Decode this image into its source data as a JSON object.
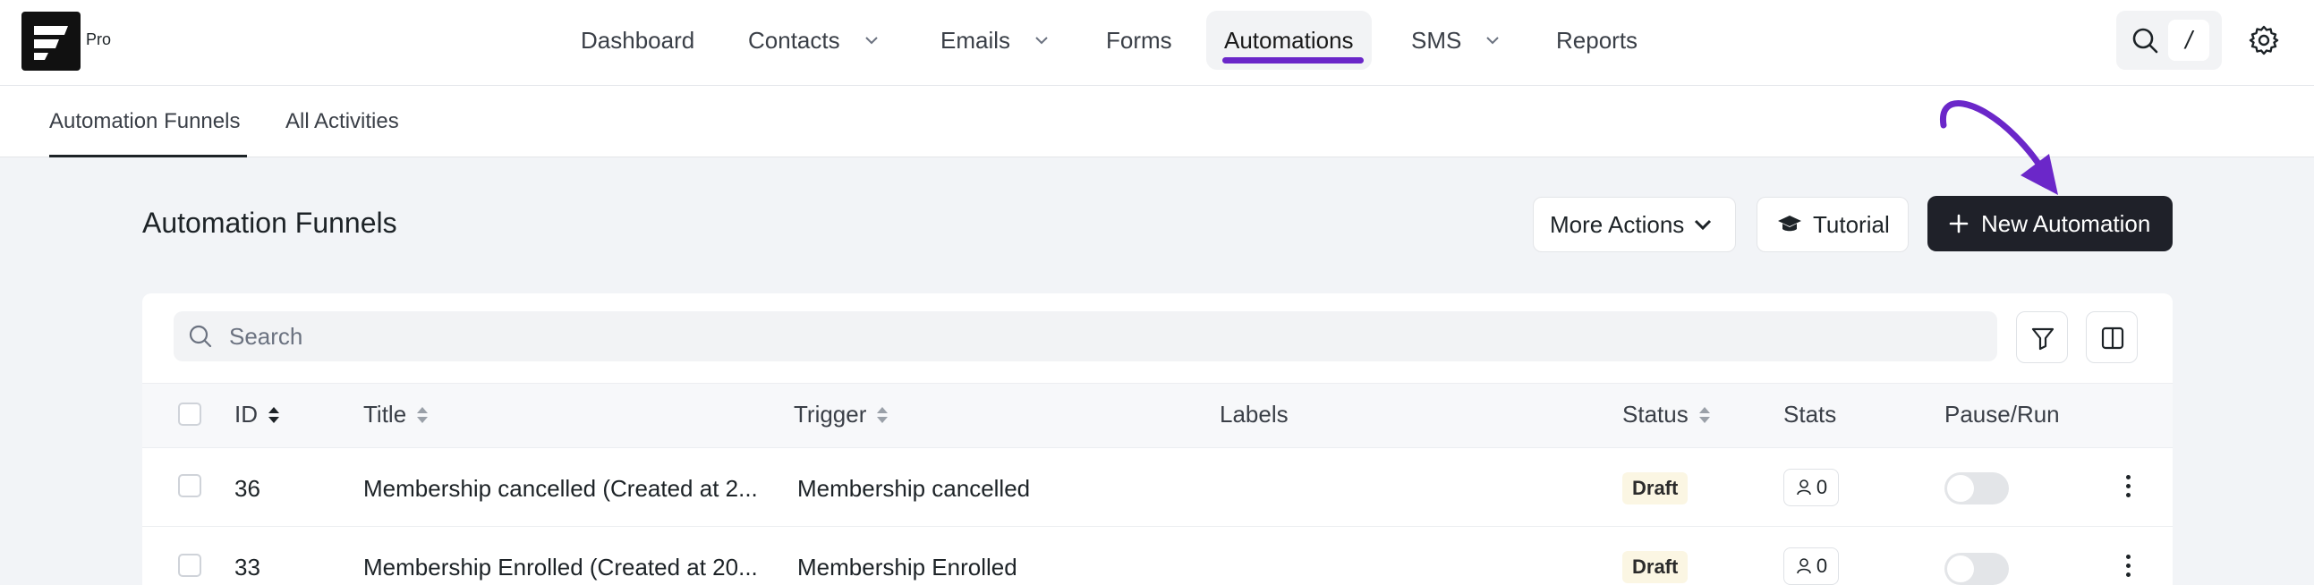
{
  "app": {
    "edition": "Pro"
  },
  "nav": {
    "items": [
      {
        "label": "Dashboard"
      },
      {
        "label": "Contacts"
      },
      {
        "label": "Emails"
      },
      {
        "label": "Forms"
      },
      {
        "label": "Automations"
      },
      {
        "label": "SMS"
      },
      {
        "label": "Reports"
      }
    ],
    "active": "Automations",
    "search_shortcut": "/"
  },
  "subtabs": [
    {
      "label": "Automation Funnels"
    },
    {
      "label": "All Activities"
    }
  ],
  "page": {
    "title": "Automation Funnels",
    "more_actions": "More Actions",
    "tutorial": "Tutorial",
    "new_automation": "New Automation"
  },
  "search": {
    "placeholder": "Search"
  },
  "table": {
    "columns": [
      "ID",
      "Title",
      "Trigger",
      "Labels",
      "Status",
      "Stats",
      "Pause/Run"
    ],
    "rows": [
      {
        "id": "36",
        "title": "Membership cancelled (Created at 2...",
        "trigger": "Membership cancelled",
        "status": "Draft",
        "stats": "0"
      },
      {
        "id": "33",
        "title": "Membership Enrolled (Created at 20...",
        "trigger": "Membership Enrolled",
        "status": "Draft",
        "stats": "0"
      }
    ]
  },
  "colors": {
    "accent": "#6b27c9",
    "primary_button": "#1f2129",
    "draft_badge": "#fbf6e3"
  }
}
